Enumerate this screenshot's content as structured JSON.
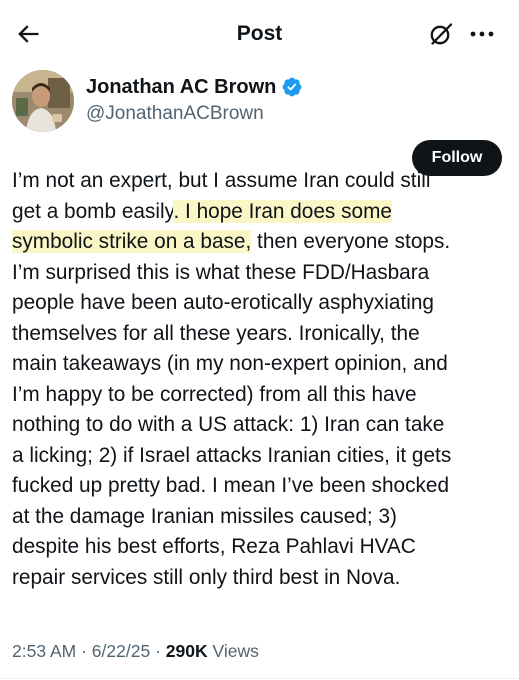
{
  "header": {
    "title": "Post",
    "back_icon": "arrow-left-icon",
    "grok_icon": "grok-icon",
    "more_icon": "more-horizontal-icon"
  },
  "author": {
    "name": "Jonathan AC Brown",
    "handle": "@JonathanACBrown",
    "verified": true,
    "follow_label": "Follow"
  },
  "post": {
    "lines": [
      {
        "parts": [
          {
            "text": "I’m not an expert, but I assume Iran could still",
            "highlight": false
          }
        ]
      },
      {
        "parts": [
          {
            "text": "get a bomb easily",
            "highlight": false
          },
          {
            "text": ". I hope Iran does some",
            "highlight": true
          }
        ]
      },
      {
        "parts": [
          {
            "text": "symbolic strike on a base,",
            "highlight": true
          },
          {
            "text": " then everyone stops.",
            "highlight": false
          }
        ]
      },
      {
        "parts": [
          {
            "text": "I’m surprised this is what these FDD/Hasbara",
            "highlight": false
          }
        ]
      },
      {
        "parts": [
          {
            "text": "people have been auto-erotically asphyxiating",
            "highlight": false
          }
        ]
      },
      {
        "parts": [
          {
            "text": "themselves for all these years. Ironically, the",
            "highlight": false
          }
        ]
      },
      {
        "parts": [
          {
            "text": "main takeaways (in my non-expert opinion, and",
            "highlight": false
          }
        ]
      },
      {
        "parts": [
          {
            "text": "I’m happy to be corrected) from all this have",
            "highlight": false
          }
        ]
      },
      {
        "parts": [
          {
            "text": "nothing to do with a US attack: 1) Iran can take",
            "highlight": false
          }
        ]
      },
      {
        "parts": [
          {
            "text": "a licking; 2) if Israel attacks Iranian cities, it gets",
            "highlight": false
          }
        ]
      },
      {
        "parts": [
          {
            "text": "fucked up pretty bad. I mean I’ve been shocked",
            "highlight": false
          }
        ]
      },
      {
        "parts": [
          {
            "text": "at the damage Iranian missiles caused; 3)",
            "highlight": false
          }
        ]
      },
      {
        "parts": [
          {
            "text": "despite his best efforts, Reza Pahlavi HVAC",
            "highlight": false
          }
        ]
      },
      {
        "parts": [
          {
            "text": "repair services still only third best in Nova.",
            "highlight": false
          }
        ]
      }
    ]
  },
  "meta": {
    "time": "2:53 AM",
    "separator": "·",
    "date": "6/22/25",
    "views_count": "290K",
    "views_label": "Views"
  },
  "colors": {
    "text": "#0f1419",
    "secondary": "#536471",
    "highlight": "#fbf6c6",
    "verified": "#1d9bf0",
    "button": "#0f1419"
  }
}
